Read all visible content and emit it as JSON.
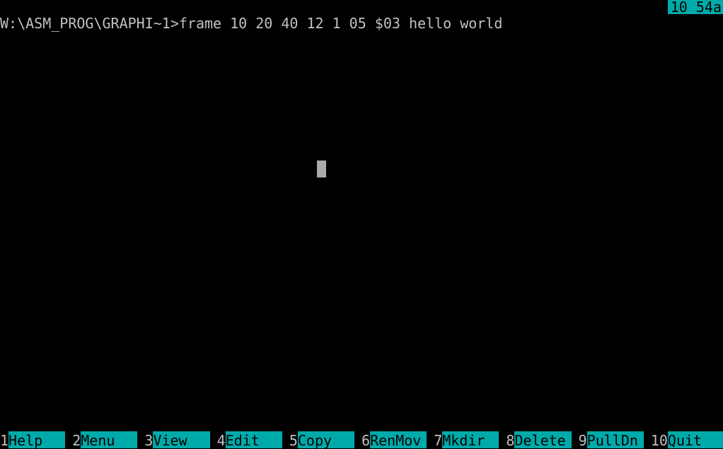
{
  "terminal": {
    "clock": "10 54a",
    "command_line": "W:\\ASM_PROG\\GRAPHI~1>frame 10 20 40 12 1 05 $03 hello world"
  },
  "function_keys": [
    {
      "number": "1",
      "label": "Help"
    },
    {
      "number": "2",
      "label": "Menu"
    },
    {
      "number": "3",
      "label": "View"
    },
    {
      "number": "4",
      "label": "Edit"
    },
    {
      "number": "5",
      "label": "Copy"
    },
    {
      "number": "6",
      "label": "RenMov"
    },
    {
      "number": "7",
      "label": "Mkdir"
    },
    {
      "number": "8",
      "label": "Delete"
    },
    {
      "number": "9",
      "label": "PullDn"
    },
    {
      "number": "10",
      "label": "Quit"
    }
  ],
  "colors": {
    "background": "#000000",
    "text": "#c0c0c0",
    "highlight": "#00aaaa",
    "cursor": "#aaaaaa"
  }
}
